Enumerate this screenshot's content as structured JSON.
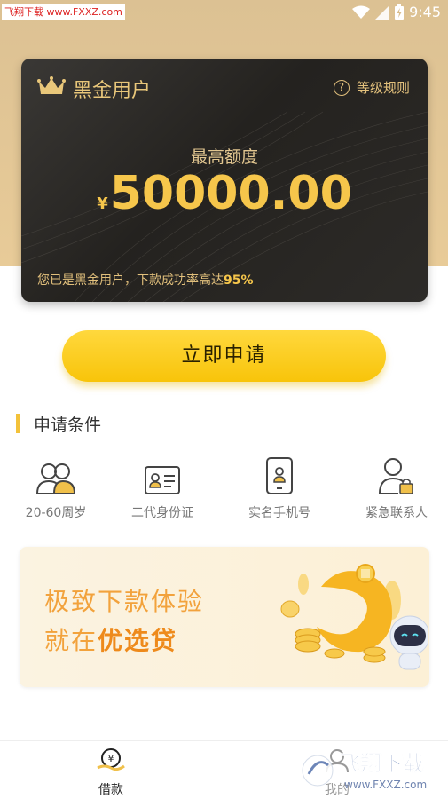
{
  "status_bar": {
    "watermark": "飞翔下载 www.FXXZ.com",
    "time": "9:45"
  },
  "card": {
    "title": "黑金用户",
    "rules_label": "等级规则",
    "rules_icon": "?",
    "quota_label": "最高额度",
    "currency": "¥",
    "amount": "50000.00",
    "note_prefix": "您已是黑金用户，下款成功率高达",
    "note_rate": "95%"
  },
  "apply_button": "立即申请",
  "conditions": {
    "title": "申请条件",
    "items": [
      {
        "label": "20-60周岁",
        "icon": "users-icon"
      },
      {
        "label": "二代身份证",
        "icon": "id-card-icon"
      },
      {
        "label": "实名手机号",
        "icon": "phone-icon"
      },
      {
        "label": "紧急联系人",
        "icon": "contact-icon"
      }
    ]
  },
  "banner": {
    "line1": "极致下款体验",
    "line2_prefix": "就在",
    "line2_bold": "优选贷"
  },
  "tabbar": {
    "tabs": [
      {
        "label": "借款",
        "icon": "loan-icon"
      },
      {
        "label": "我的",
        "icon": "profile-icon"
      }
    ]
  },
  "watermark_br": {
    "text": "飞翔下载",
    "url": "www.FXXZ.com"
  },
  "colors": {
    "accent": "#f8c40a",
    "gold": "#e9c77a",
    "card_bg": "#2a2825",
    "header_bg": "#e0c493"
  }
}
